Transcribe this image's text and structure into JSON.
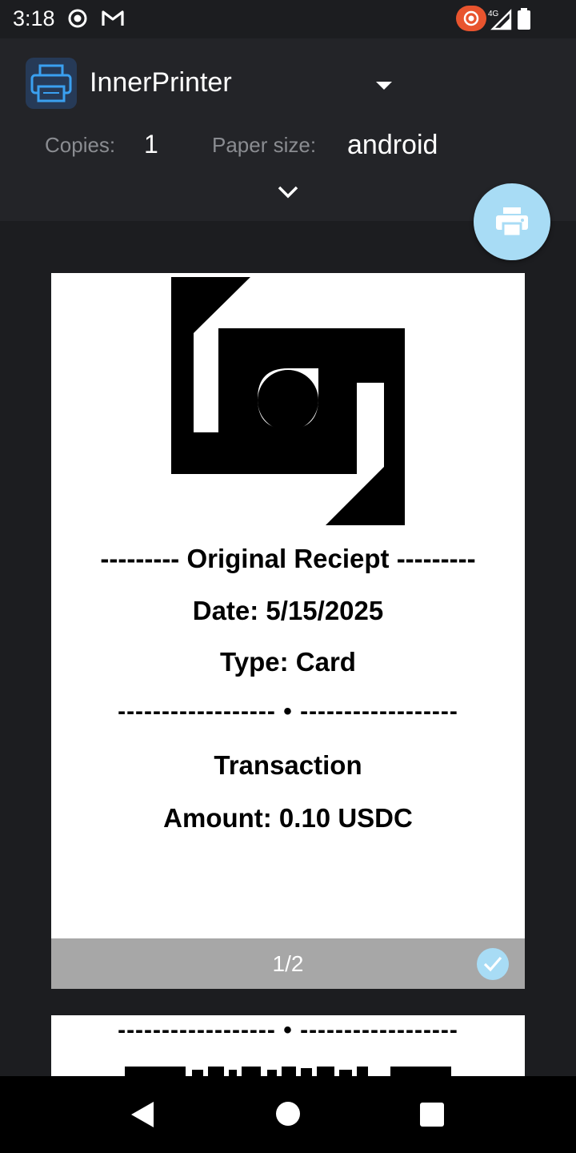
{
  "status_bar": {
    "time": "3:18",
    "network": "4G",
    "icons": [
      "screen-record-icon",
      "gmail-icon",
      "cast-icon",
      "signal-icon",
      "battery-icon"
    ]
  },
  "header": {
    "printer_name": "InnerPrinter",
    "copies_label": "Copies:",
    "copies_value": "1",
    "paper_size_label": "Paper size:",
    "paper_size_value": "android"
  },
  "colors": {
    "background": "#1c1d20",
    "header": "#232428",
    "accent": "#a8dcf5",
    "footer_gray": "#a7a7a7"
  },
  "preview": {
    "page1": {
      "title_line": "--------- Original Reciept ---------",
      "date_line": "Date: 5/15/2025",
      "type_line": "Type: Card",
      "divider": "------------------ • ------------------",
      "transaction_label": "Transaction",
      "amount_line": "Amount: 0.10 USDC",
      "page_number": "1/2",
      "selected": true
    },
    "page2": {
      "divider": "------------------ • ------------------"
    }
  },
  "nav": {
    "buttons": [
      "back-icon",
      "home-icon",
      "recents-icon"
    ]
  }
}
